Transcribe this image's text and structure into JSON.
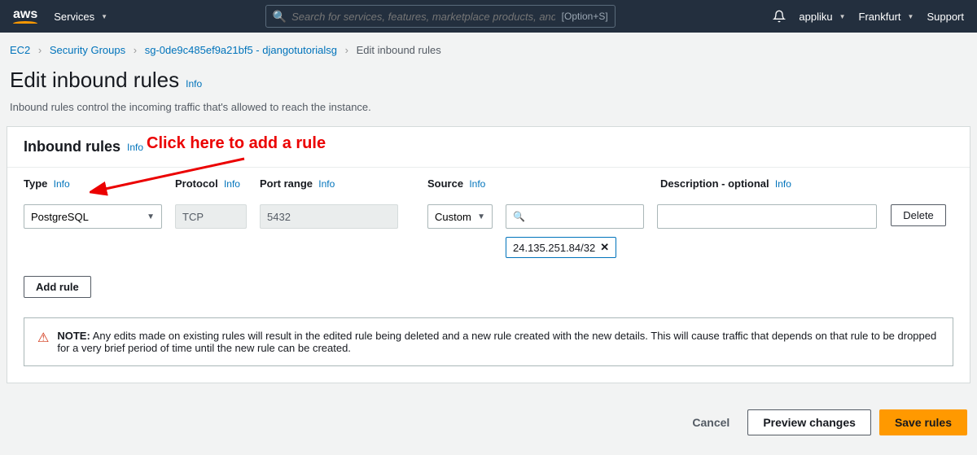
{
  "nav": {
    "logo_text": "aws",
    "services_label": "Services",
    "search_placeholder": "Search for services, features, marketplace products, and docs",
    "search_hint": "[Option+S]",
    "username": "appliku",
    "region": "Frankfurt",
    "support_label": "Support"
  },
  "breadcrumb": {
    "items": [
      "EC2",
      "Security Groups",
      "sg-0de9c485ef9a21bf5 - djangotutorialsg"
    ],
    "current": "Edit inbound rules"
  },
  "page": {
    "title": "Edit inbound rules",
    "info_label": "Info",
    "subtitle": "Inbound rules control the incoming traffic that's allowed to reach the instance."
  },
  "panel": {
    "title": "Inbound rules",
    "columns": {
      "type": "Type",
      "protocol": "Protocol",
      "port": "Port range",
      "source": "Source",
      "description": "Description - optional"
    },
    "row": {
      "type_value": "PostgreSQL",
      "protocol_value": "TCP",
      "port_value": "5432",
      "source_mode": "Custom",
      "source_cidr": "24.135.251.84/32",
      "description_value": ""
    },
    "delete_label": "Delete",
    "add_rule_label": "Add rule"
  },
  "annotation": {
    "text": "Click here to add a rule"
  },
  "note": {
    "label": "NOTE:",
    "text": "Any edits made on existing rules will result in the edited rule being deleted and a new rule created with the new details. This will cause traffic that depends on that rule to be dropped for a very brief period of time until the new rule can be created."
  },
  "footer": {
    "cancel": "Cancel",
    "preview": "Preview changes",
    "save": "Save rules"
  }
}
